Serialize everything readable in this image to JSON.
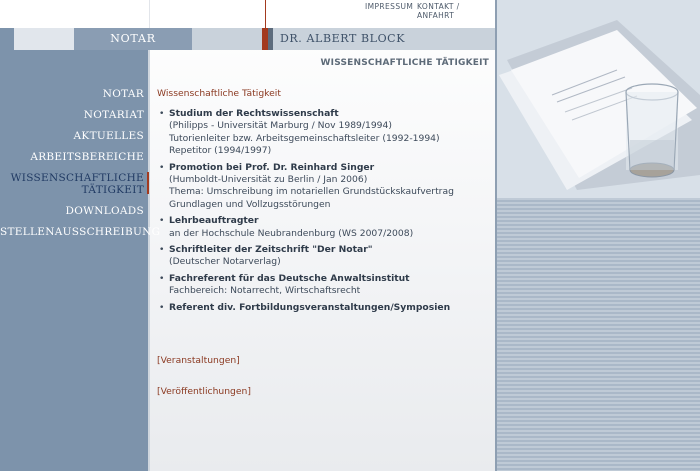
{
  "topnav": {
    "impressum": "IMPRESSUM",
    "kontakt": "KONTAKT / ANFAHRT"
  },
  "header": {
    "notar": "NOTAR",
    "name": "DR. ALBERT BLOCK"
  },
  "section_title": "WISSENSCHAFTLICHE TÄTIGKEIT",
  "nav": {
    "items": [
      {
        "label": "NOTAR"
      },
      {
        "label": "NOTARIAT"
      },
      {
        "label": "AKTUELLES"
      },
      {
        "label": "ARBEITSBEREICHE"
      },
      {
        "label_line1": "WISSENSCHAFTLICHE",
        "label_line2": "TÄTIGKEIT",
        "active": true
      },
      {
        "label": "DOWNLOADS"
      },
      {
        "label": "STELLENAUSSCHREIBUNG"
      }
    ]
  },
  "content": {
    "heading": "Wissenschaftliche Tätigkeit",
    "items": [
      {
        "title": "Studium der Rechtswissenschaft",
        "lines": [
          "(Philipps - Universität Marburg / Nov 1989/1994)",
          "Tutorienleiter bzw. Arbeitsgemeinschaftsleiter (1992-1994)",
          "Repetitor (1994/1997)"
        ]
      },
      {
        "title": "Promotion bei Prof. Dr. Reinhard Singer",
        "lines": [
          "(Humboldt-Universität zu Berlin / Jan 2006)",
          "Thema: Umschreibung im notariellen Grundstückskaufvertrag",
          "Grundlagen und Vollzugsstörungen"
        ]
      },
      {
        "title": "Lehrbeauftragter",
        "lines": [
          "an der Hochschule Neubrandenburg (WS 2007/2008)"
        ]
      },
      {
        "title": "Schriftleiter der Zeitschrift \"Der Notar\"",
        "lines": [
          "(Deutscher Notarverlag)"
        ]
      },
      {
        "title": "Fachreferent für das Deutsche Anwaltsinstitut",
        "lines": [
          "Fachbereich: Notarrecht, Wirtschaftsrecht"
        ]
      },
      {
        "title": "Referent div. Fortbildungsveranstaltungen/Symposien",
        "lines": []
      }
    ]
  },
  "links": {
    "veranstaltungen": "[Veranstaltungen]",
    "veroeffentlichungen": "[Veröffentlichungen]"
  },
  "colors": {
    "nav_bg": "#7d93ab",
    "accent": "#a33a1f",
    "link": "#8b3a22",
    "active_nav": "#203a63"
  }
}
